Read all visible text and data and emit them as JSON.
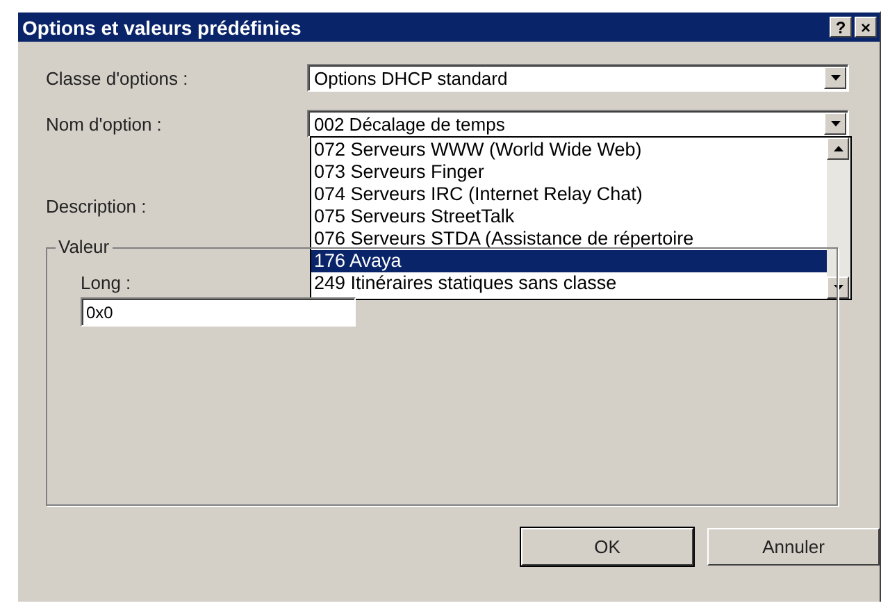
{
  "window": {
    "title": "Options et valeurs prédéfinies",
    "help_button": "?",
    "close_button": "×"
  },
  "option_class": {
    "label": "Classe d'options :",
    "value": "Options DHCP standard"
  },
  "option_name": {
    "label": "Nom d'option :",
    "value": "002 Décalage de temps",
    "dropdown": {
      "expanded": true,
      "items": [
        {
          "label": "072 Serveurs WWW (World Wide Web)",
          "selected": false
        },
        {
          "label": "073 Serveurs Finger",
          "selected": false
        },
        {
          "label": "074 Serveurs IRC (Internet Relay Chat)",
          "selected": false
        },
        {
          "label": "075 Serveurs StreetTalk",
          "selected": false
        },
        {
          "label": "076 Serveurs STDA (Assistance de répertoire",
          "selected": false
        },
        {
          "label": "176 Avaya",
          "selected": true
        },
        {
          "label": "249 Itinéraires statiques sans classe",
          "selected": false
        }
      ]
    }
  },
  "description": {
    "label": "Description :"
  },
  "value_group": {
    "title": "Valeur",
    "field_label": "Long :",
    "field_value": "0x0"
  },
  "buttons": [
    {
      "label": "OK",
      "default": true
    },
    {
      "label": "Annuler",
      "default": false
    }
  ]
}
